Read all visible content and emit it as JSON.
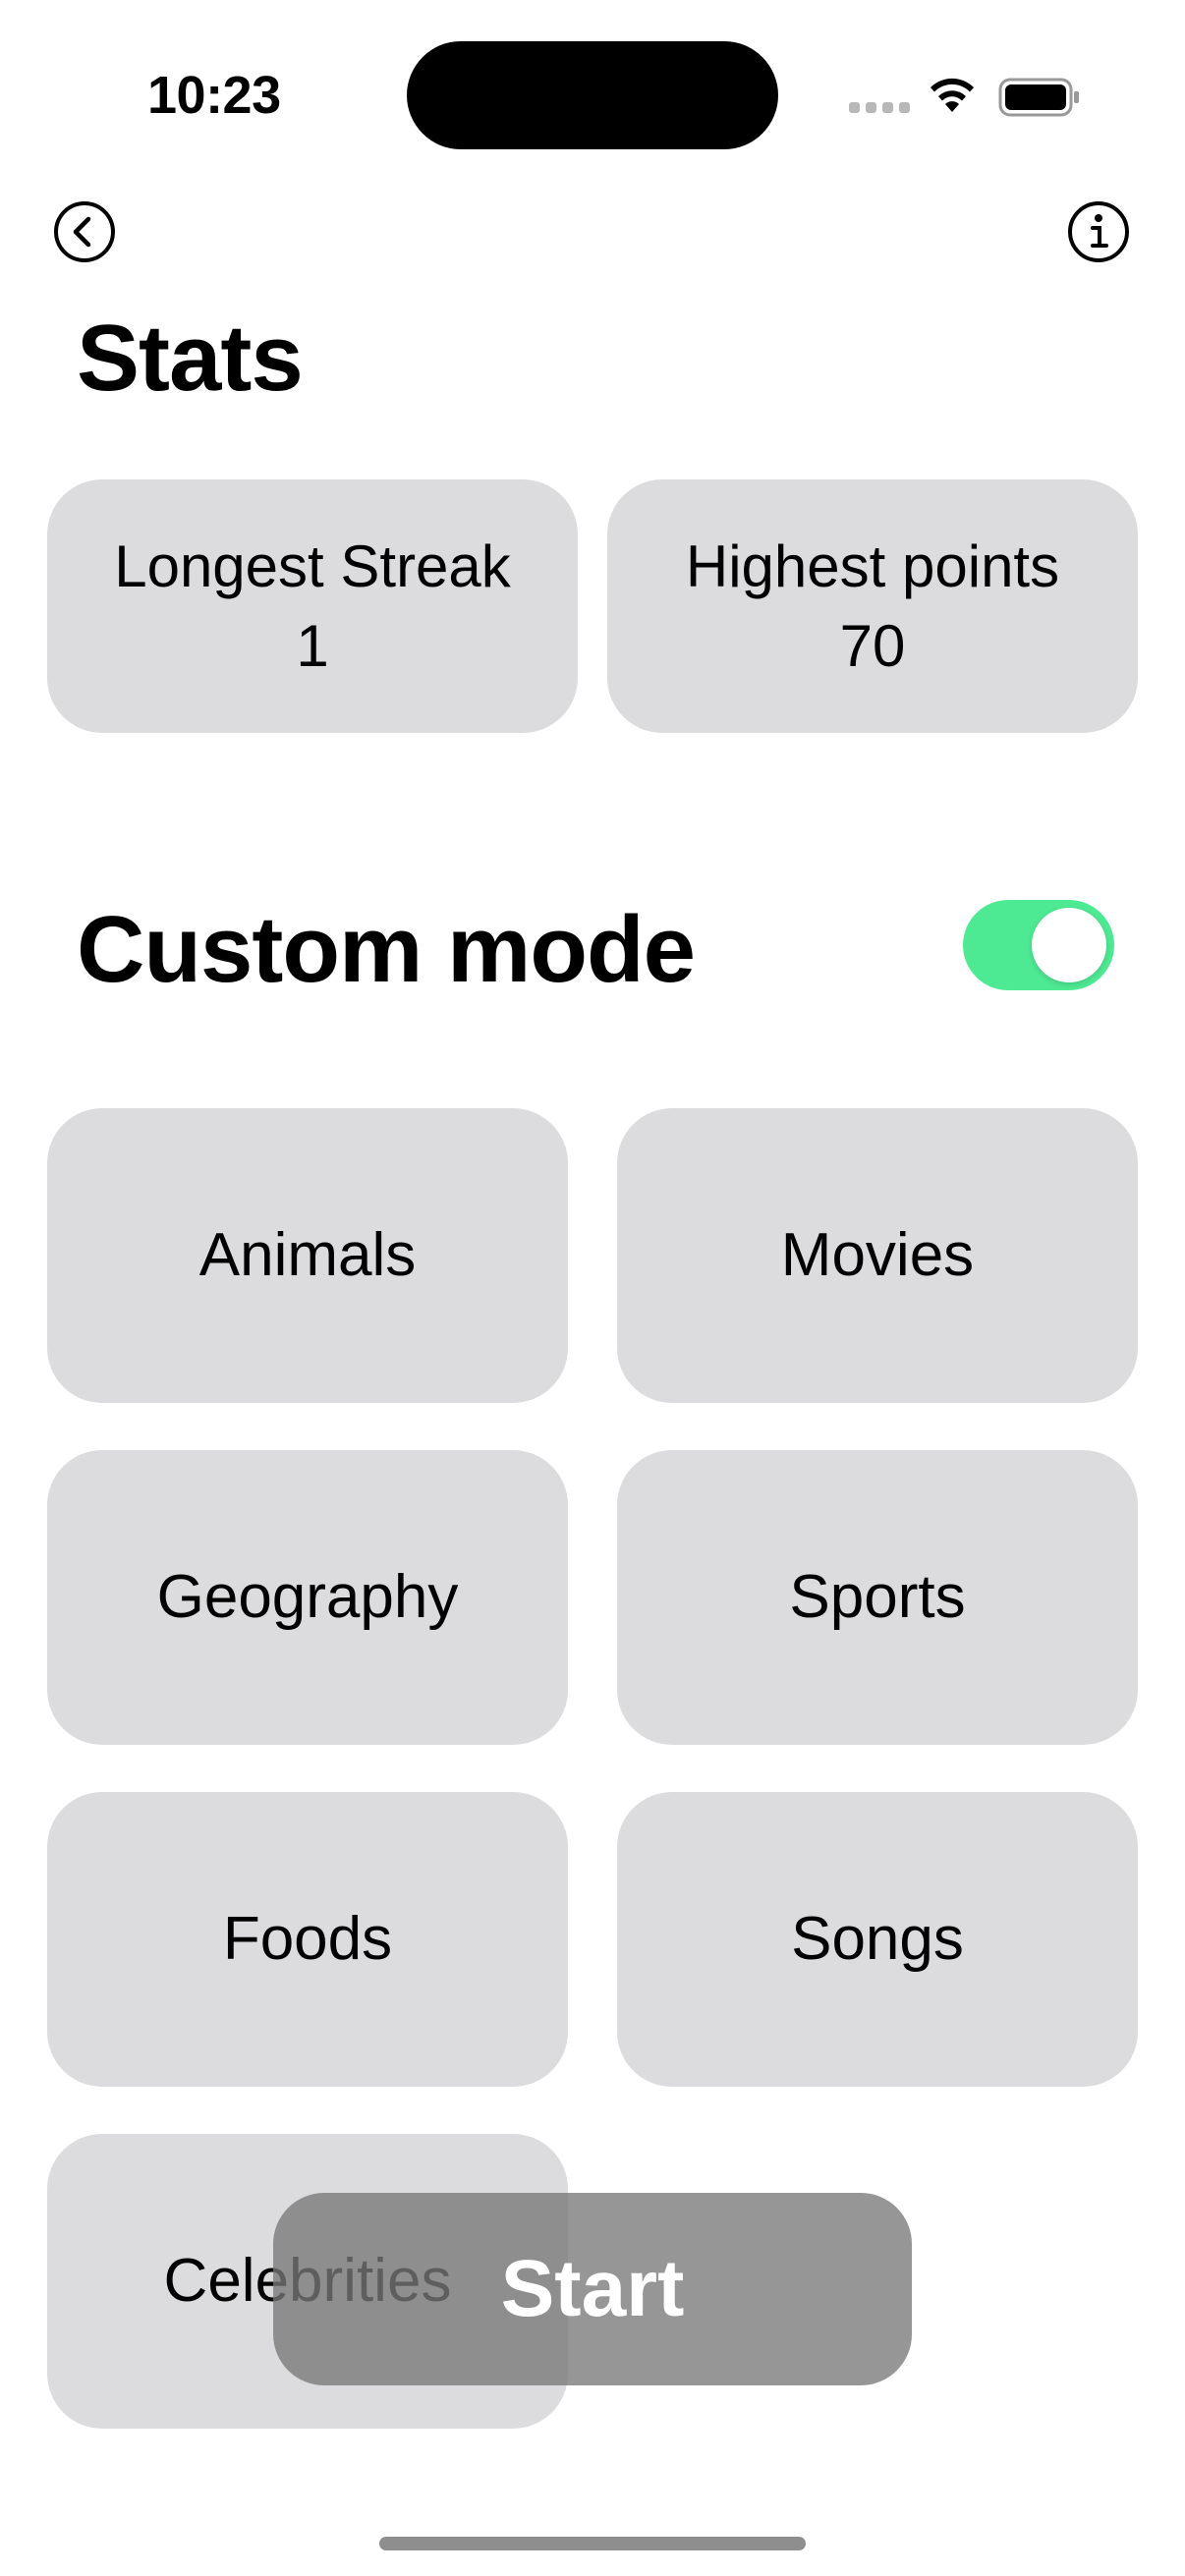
{
  "status_bar": {
    "time": "10:23"
  },
  "nav": {
    "back_icon": "chevron-left-circle-icon",
    "info_icon": "info-circle-icon"
  },
  "stats": {
    "title": "Stats",
    "longest_streak_label": "Longest Streak",
    "longest_streak_value": "1",
    "highest_points_label": "Highest points",
    "highest_points_value": "70"
  },
  "custom_mode": {
    "title": "Custom mode",
    "toggle_on": true,
    "toggle_color": "#4ee993"
  },
  "categories": [
    "Animals",
    "Movies",
    "Geography",
    "Sports",
    "Foods",
    "Songs",
    "Celebrities"
  ],
  "start_button": {
    "label": "Start"
  }
}
